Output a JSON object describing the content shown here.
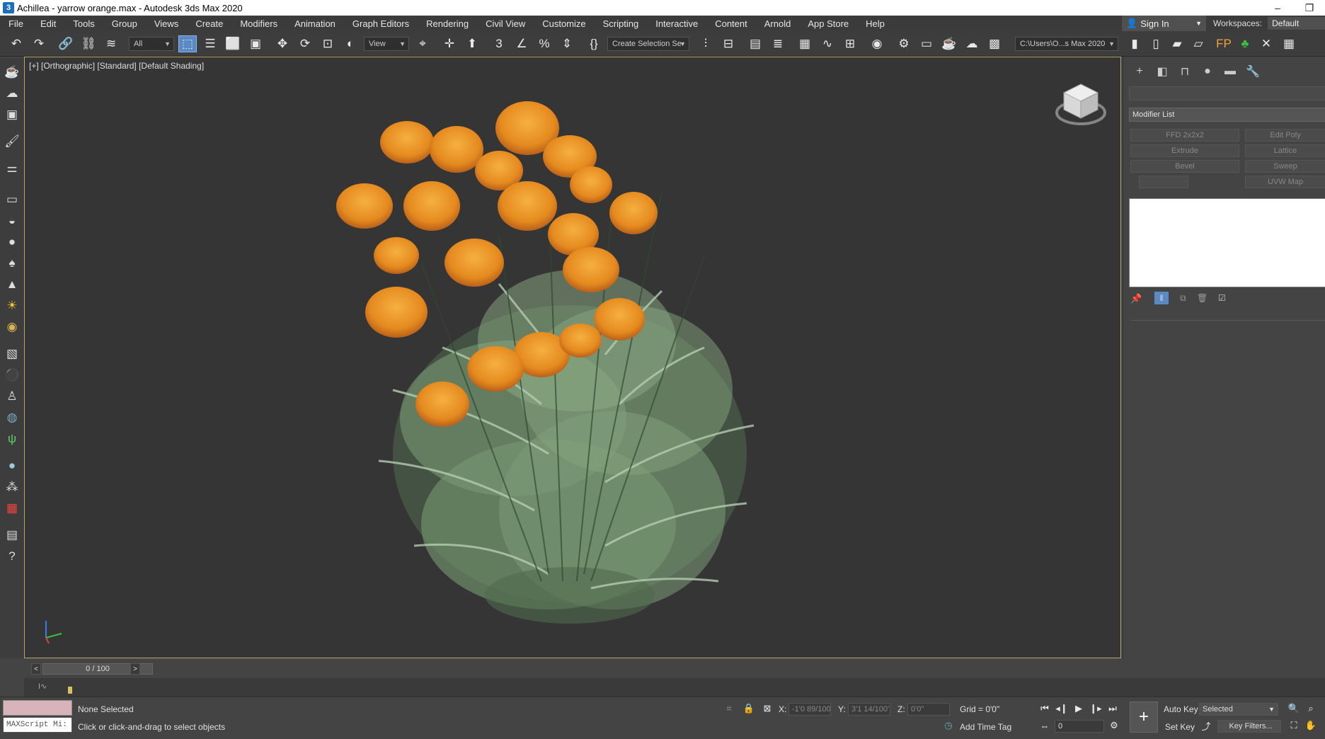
{
  "window": {
    "title": "Achillea - yarrow orange.max - Autodesk 3ds Max 2020",
    "minimize": "–",
    "restore": "❐"
  },
  "menu": [
    "File",
    "Edit",
    "Tools",
    "Group",
    "Views",
    "Create",
    "Modifiers",
    "Animation",
    "Graph Editors",
    "Rendering",
    "Civil View",
    "Customize",
    "Scripting",
    "Interactive",
    "Content",
    "Arnold",
    "App Store",
    "Help"
  ],
  "account": {
    "sign_in": "Sign In",
    "workspaces_label": "Workspaces:",
    "workspace_value": "Default"
  },
  "toolbar": {
    "selection_filter": "All",
    "ref_coord": "View",
    "named_selection": "Create Selection Se",
    "project_path": "C:\\Users\\O...s Max 2020"
  },
  "viewport": {
    "label": "[+] [Orthographic] [Standard] [Default Shading]",
    "viewcube_label": "",
    "colors": {
      "background": "#353535",
      "petal": "#e58a1f",
      "leaf": "#6f8f6a",
      "border": "#b7a86a"
    }
  },
  "command_panel": {
    "modifier_list": "Modifier List",
    "buttons": [
      "FFD 2x2x2",
      "Edit Poly",
      "Extrude",
      "Lattice",
      "Bevel",
      "Sweep",
      "",
      "UVW Map"
    ]
  },
  "timeline": {
    "frame_display": "0 / 100",
    "prev": "<",
    "next": ">"
  },
  "status": {
    "selection": "None Selected",
    "prompt": "Click or click-and-drag to select objects",
    "maxscript": "MAXScript Mi:",
    "x_label": "X:",
    "x_value": "-1'0 89/100",
    "y_label": "Y:",
    "y_value": "3'1 14/100'",
    "z_label": "Z:",
    "z_value": "0'0\"",
    "grid": "Grid = 0'0\"",
    "add_time_tag": "Add Time Tag",
    "auto_key": "Auto Key",
    "set_key": "Set Key",
    "key_mode": "Selected",
    "key_filters": "Key Filters...",
    "current_frame": "0"
  }
}
